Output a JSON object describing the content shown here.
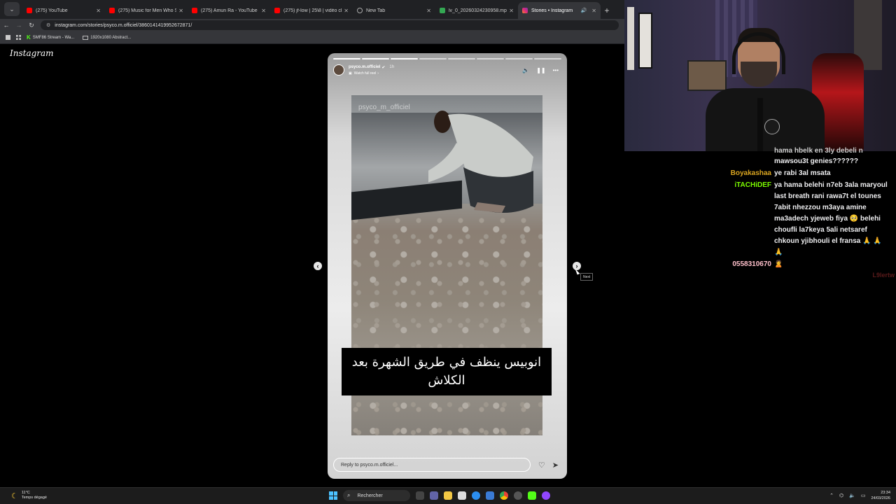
{
  "browser": {
    "tabs": [
      {
        "label": "(275) YouTube",
        "icon": "youtube-icon",
        "active": false
      },
      {
        "label": "(275) Music for Men Who Stay",
        "icon": "youtube-icon",
        "active": false
      },
      {
        "label": "(275) Amun Ra - YouTube",
        "icon": "youtube-icon",
        "active": false
      },
      {
        "label": "(275) jf-low | 25\\8 | vidéo clip",
        "icon": "youtube-icon",
        "active": false
      },
      {
        "label": "New Tab",
        "icon": "globe-icon",
        "active": false
      },
      {
        "label": "lv_0_20260324230958.mp4 - G",
        "icon": "drive-icon",
        "active": false
      },
      {
        "label": "Stories • Instagram",
        "icon": "instagram-icon",
        "active": true
      }
    ],
    "url": "instagram.com/stories/psyco.m.officiel/3860141419952672871/",
    "bookmarks": [
      {
        "label": "SMF86 Stream - Wa...",
        "icon": "kick-icon"
      },
      {
        "label": "1920x1080 Abstract...",
        "icon": "image-icon"
      }
    ]
  },
  "instagram": {
    "logo": "Instagram",
    "story": {
      "username": "psyco.m.officiel",
      "time_ago": "1h",
      "watch_label": "Watch full reel",
      "watermark": "psyco_m_officiel",
      "caption": "انوبيس ينظف في طريق الشهرة بعد الكلاش",
      "reply_placeholder": "Reply to psyco.m.officiel...",
      "progress_segments": 8,
      "progress_done": 3
    },
    "next_tooltip": "Next"
  },
  "taskbar": {
    "weather_temp": "11°C",
    "weather_desc": "Temps dégagé",
    "search_label": "Rechercher",
    "time": "23:34",
    "date": "24/03/2026"
  },
  "chat": {
    "messages": [
      {
        "user": "",
        "user_color": "#b22222",
        "text": "hama hbelk en 3ly debeli n"
      },
      {
        "user": "",
        "user_color": "#b22222",
        "text": "mawsou3t genies??????"
      },
      {
        "user": "Boyakashaa",
        "user_color": "#daa520",
        "text": "ye rabi 3al msata"
      },
      {
        "user": "iTACHiDEF",
        "user_color": "#7cfc00",
        "text": "ya hama belehi n7eb 3ala maryoul last breath rani rawa7t el tounes 7abit nhezzou m3aya amine ma3adech yjeweb fiya 🥺 belehi choufli la7keya 5ali netsaref chkoun yjibhouli el fransa 🙏 🙏 🙏"
      },
      {
        "user": "0558310670",
        "user_color": "#ffc0cb",
        "text": "🙎"
      }
    ],
    "faded_name": "L9lertw"
  }
}
